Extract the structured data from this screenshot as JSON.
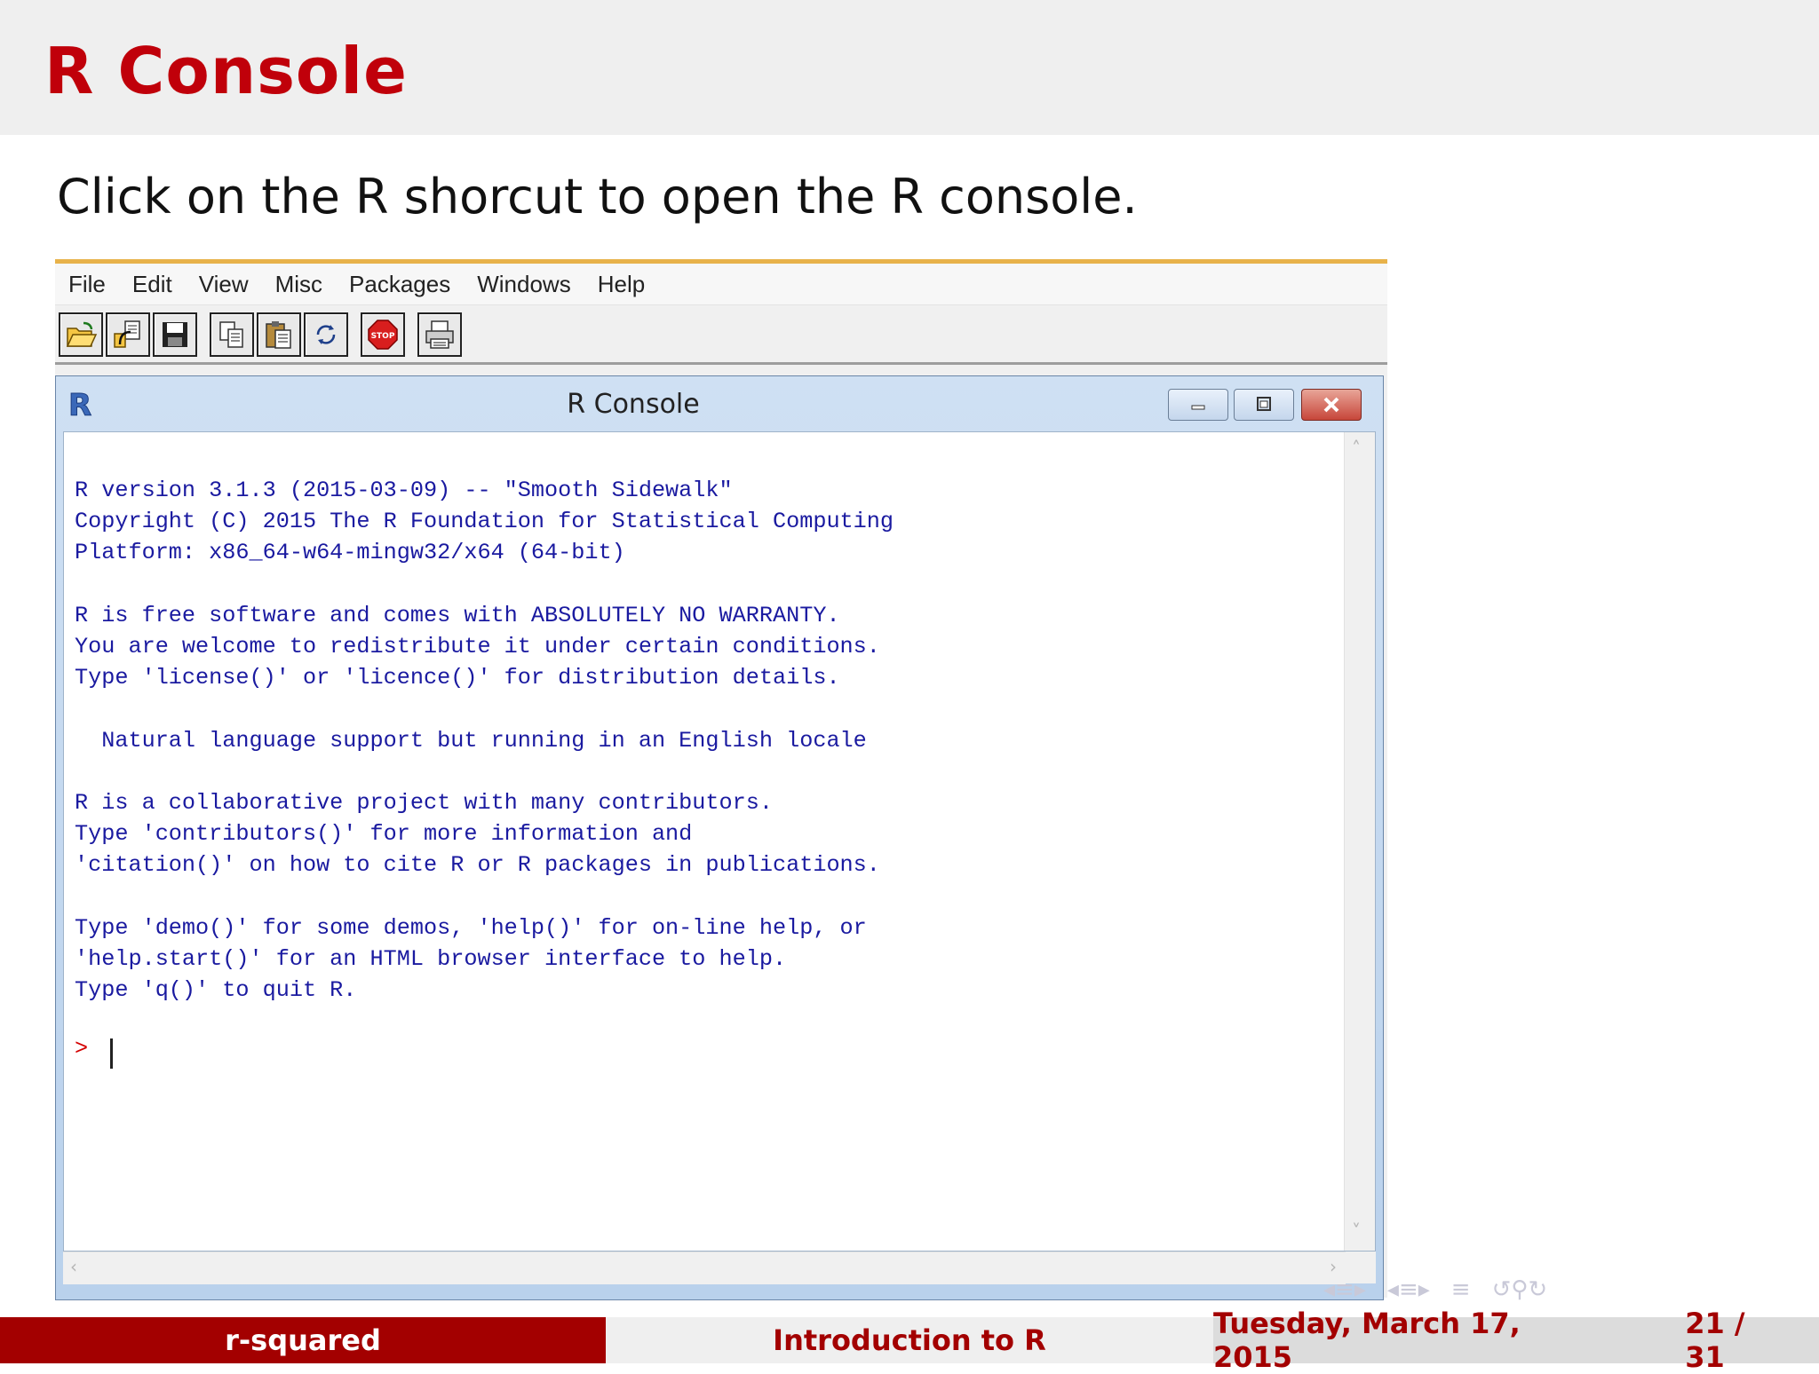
{
  "slide": {
    "title": "R Console",
    "subtitle": "Click on the R shorcut to open the R console."
  },
  "rgui": {
    "menu": [
      "File",
      "Edit",
      "View",
      "Misc",
      "Packages",
      "Windows",
      "Help"
    ],
    "toolbar_icons": [
      "open-script-icon",
      "load-workspace-icon",
      "save-icon",
      "copy-icon",
      "paste-icon",
      "refresh-icon",
      "stop-icon",
      "print-icon"
    ],
    "stop_label": "STOP",
    "console_window": {
      "title": "R Console",
      "output": "R version 3.1.3 (2015-03-09) -- \"Smooth Sidewalk\"\nCopyright (C) 2015 The R Foundation for Statistical Computing\nPlatform: x86_64-w64-mingw32/x64 (64-bit)\n\nR is free software and comes with ABSOLUTELY NO WARRANTY.\nYou are welcome to redistribute it under certain conditions.\nType 'license()' or 'licence()' for distribution details.\n\n  Natural language support but running in an English locale\n\nR is a collaborative project with many contributors.\nType 'contributors()' for more information and\n'citation()' on how to cite R or R packages in publications.\n\nType 'demo()' for some demos, 'help()' for on-line help, or\n'help.start()' for an HTML browser interface to help.\nType 'q()' to quit R.",
      "prompt": ">"
    }
  },
  "footer": {
    "author": "r-squared",
    "talk_title": "Introduction to R",
    "date": "Tuesday, March 17, 2015",
    "page": "21 / 31"
  },
  "colors": {
    "accent_red": "#c0000a",
    "footer_red": "#a30000",
    "console_text": "#1a1aa0"
  }
}
